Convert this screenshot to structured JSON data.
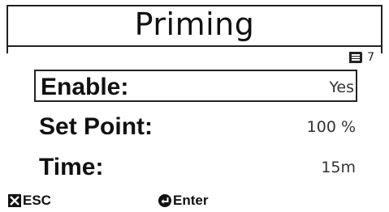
{
  "header": {
    "title": "Priming"
  },
  "page_indicator": {
    "icon": "menu-list-icon",
    "number": "7"
  },
  "settings": [
    {
      "label": "Enable:",
      "value": "Yes",
      "selected": true
    },
    {
      "label": "Set Point:",
      "value": "100 %",
      "selected": false
    },
    {
      "label": "Time:",
      "value": "15m",
      "selected": false
    }
  ],
  "softkeys": {
    "esc_label": "ESC",
    "esc_icon": "x-icon",
    "enter_label": "Enter",
    "enter_icon": "enter-arrow-icon"
  }
}
